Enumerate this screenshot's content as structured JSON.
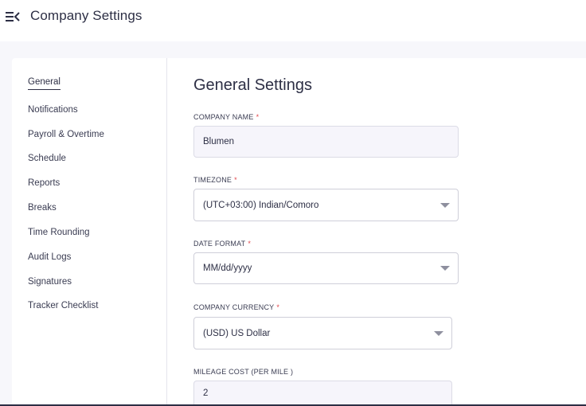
{
  "header": {
    "title": "Company Settings",
    "menu_icon": "collapse-menu-icon"
  },
  "sidebar": {
    "items": [
      {
        "label": "General",
        "active": true
      },
      {
        "label": "Notifications"
      },
      {
        "label": "Payroll & Overtime"
      },
      {
        "label": "Schedule"
      },
      {
        "label": "Reports"
      },
      {
        "label": "Breaks"
      },
      {
        "label": "Time Rounding"
      },
      {
        "label": "Audit Logs"
      },
      {
        "label": "Signatures"
      },
      {
        "label": "Tracker Checklist"
      }
    ]
  },
  "main": {
    "title": "General Settings",
    "fields": {
      "company_name": {
        "label": "COMPANY NAME",
        "required": "*",
        "value": "Blumen"
      },
      "timezone": {
        "label": "TIMEZONE",
        "required": "*",
        "value": "(UTC+03:00) Indian/Comoro"
      },
      "date_format": {
        "label": "DATE FORMAT",
        "required": "*",
        "value": "MM/dd/yyyy"
      },
      "company_currency": {
        "label": "COMPANY CURRENCY",
        "required": "*",
        "value": "(USD) US Dollar"
      },
      "mileage_cost": {
        "label": "MILEAGE COST (PER MILE )",
        "value": "2"
      }
    }
  },
  "colors": {
    "text": "#2d2f45",
    "required": "#e0474c",
    "background": "#f7f7fb"
  }
}
